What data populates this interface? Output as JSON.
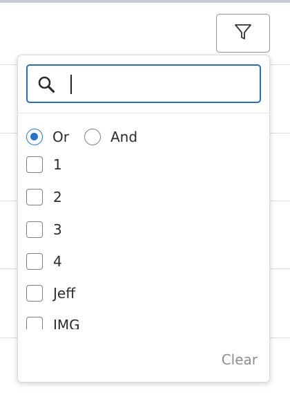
{
  "filter": {
    "toggle_icon": "filter-icon",
    "search": {
      "icon": "search-icon",
      "value": "",
      "placeholder": ""
    },
    "logic": {
      "selected": "Or",
      "options": [
        "Or",
        "And"
      ]
    },
    "values": [
      "1",
      "2",
      "3",
      "4",
      "Jeff",
      "IMG"
    ],
    "clear_label": "Clear"
  },
  "colors": {
    "accent": "#2b72c7",
    "focus_border": "#2b6cb0",
    "muted_text": "#8a8f94"
  }
}
